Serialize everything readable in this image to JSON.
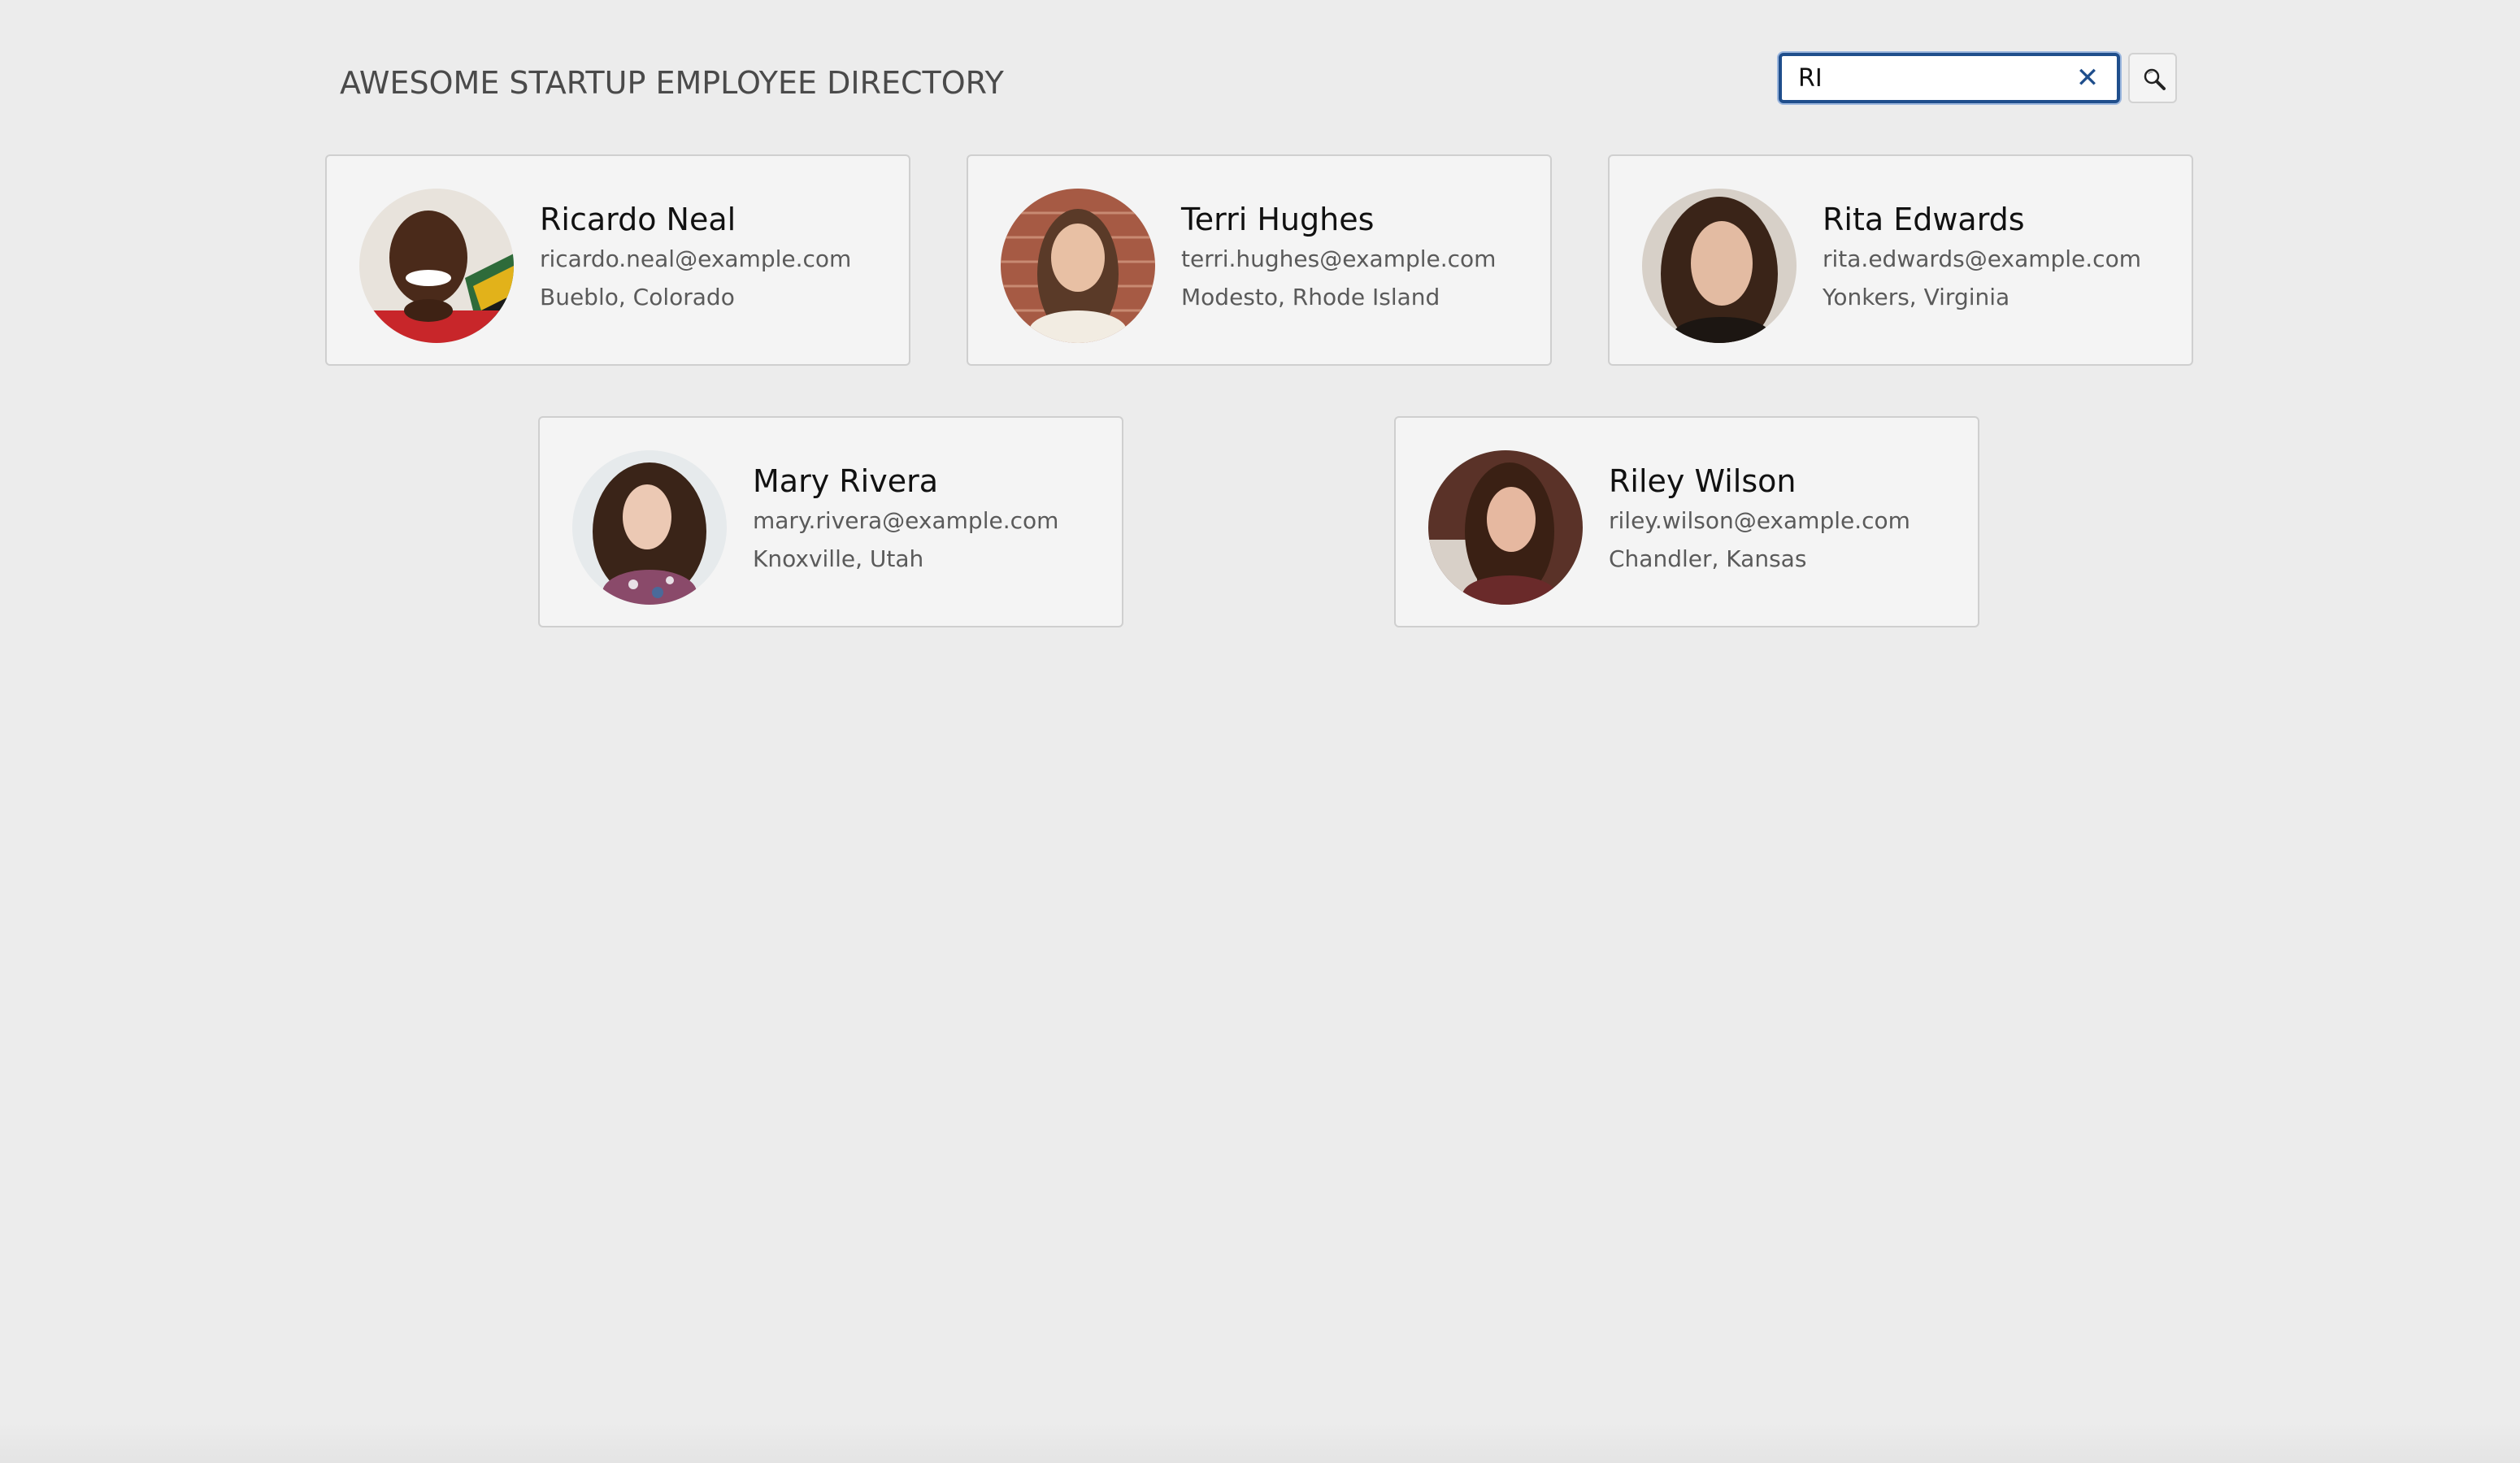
{
  "header": {
    "title": "AWESOME STARTUP EMPLOYEE DIRECTORY"
  },
  "search": {
    "value": "RI",
    "clear_glyph": "✕",
    "clear_icon": "close-icon",
    "button_icon": "search-icon"
  },
  "colors": {
    "page_background": "#ececec",
    "card_background": "#f4f4f4",
    "search_border": "#1f4e8c"
  },
  "employees": [
    {
      "name": "Ricardo Neal",
      "email": "ricardo.neal@example.com",
      "location": "Bueblo, Colorado"
    },
    {
      "name": "Terri Hughes",
      "email": "terri.hughes@example.com",
      "location": "Modesto, Rhode Island"
    },
    {
      "name": "Rita Edwards",
      "email": "rita.edwards@example.com",
      "location": "Yonkers, Virginia"
    },
    {
      "name": "Mary Rivera",
      "email": "mary.rivera@example.com",
      "location": "Knoxville, Utah"
    },
    {
      "name": "Riley Wilson",
      "email": "riley.wilson@example.com",
      "location": "Chandler, Kansas"
    }
  ]
}
